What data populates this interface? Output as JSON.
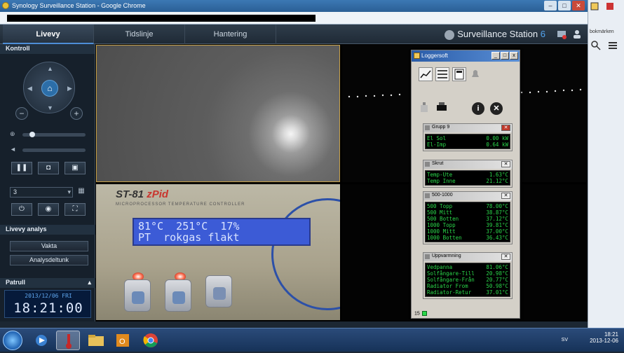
{
  "window": {
    "title": "Synology Surveillance Station - Google Chrome"
  },
  "nav": {
    "tabs": [
      "Livevy",
      "Tidslinje",
      "Hantering"
    ],
    "brand": "Surveillance Station",
    "brand_version": "6"
  },
  "left": {
    "kontroll_label": "Kontroll",
    "camera_select": "3",
    "analys_label": "Livevy analys",
    "vakta_label": "Vakta",
    "analyslunk_label": "Analysdeltunk",
    "patrull_label": "Patrull",
    "clock_date": "2013/12/06 FRI",
    "clock_time": "18:21:00"
  },
  "cam3": {
    "model": "ST-81",
    "model_suffix": "zPid",
    "subtitle": "MICROPROCESSOR TEMPERATURE CONTROLLER",
    "lcd_line1": "81°C  251°C  17%",
    "lcd_line2": "PT  rokgas flakt"
  },
  "logger": {
    "title": "Loggersoft",
    "groups": [
      {
        "title": "Grupp 9",
        "close_red": true,
        "rows": [
          [
            "El Sol",
            "0.00 kW"
          ],
          [
            "El-Imp",
            "0.64 kW"
          ]
        ]
      },
      {
        "title": "Skrut",
        "close_red": false,
        "rows": [
          [
            "Temp-Ute",
            "1.63°C"
          ],
          [
            "Temp Inne",
            "21.12°C"
          ]
        ]
      },
      {
        "title": "500-1000",
        "close_red": false,
        "rows": [
          [
            "500 Topp",
            "78.00°C"
          ],
          [
            "500 Mitt",
            "38.87°C"
          ],
          [
            "500 Botten",
            "37.12°C"
          ],
          [
            "1000 Topp",
            "39.81°C"
          ],
          [
            "1000 Mitt",
            "37.00°C"
          ],
          [
            "1000 Botten",
            "36.43°C"
          ]
        ]
      },
      {
        "title": "Uppvarmning",
        "close_red": false,
        "rows": [
          [
            "Vedpanna",
            "81.06°C"
          ],
          [
            "Solfångare-Till",
            "20.98°C"
          ],
          [
            "Solfångare-Från",
            "20.77°C"
          ],
          [
            "Radiator From",
            "50.98°C"
          ],
          [
            "Radiator-Retur",
            "37.01°C"
          ]
        ]
      }
    ],
    "footer_count": "15"
  },
  "side": {
    "label": "bokmärken"
  },
  "taskbar": {
    "lang": "SV",
    "time": "18:21",
    "date": "2013-12-06"
  }
}
